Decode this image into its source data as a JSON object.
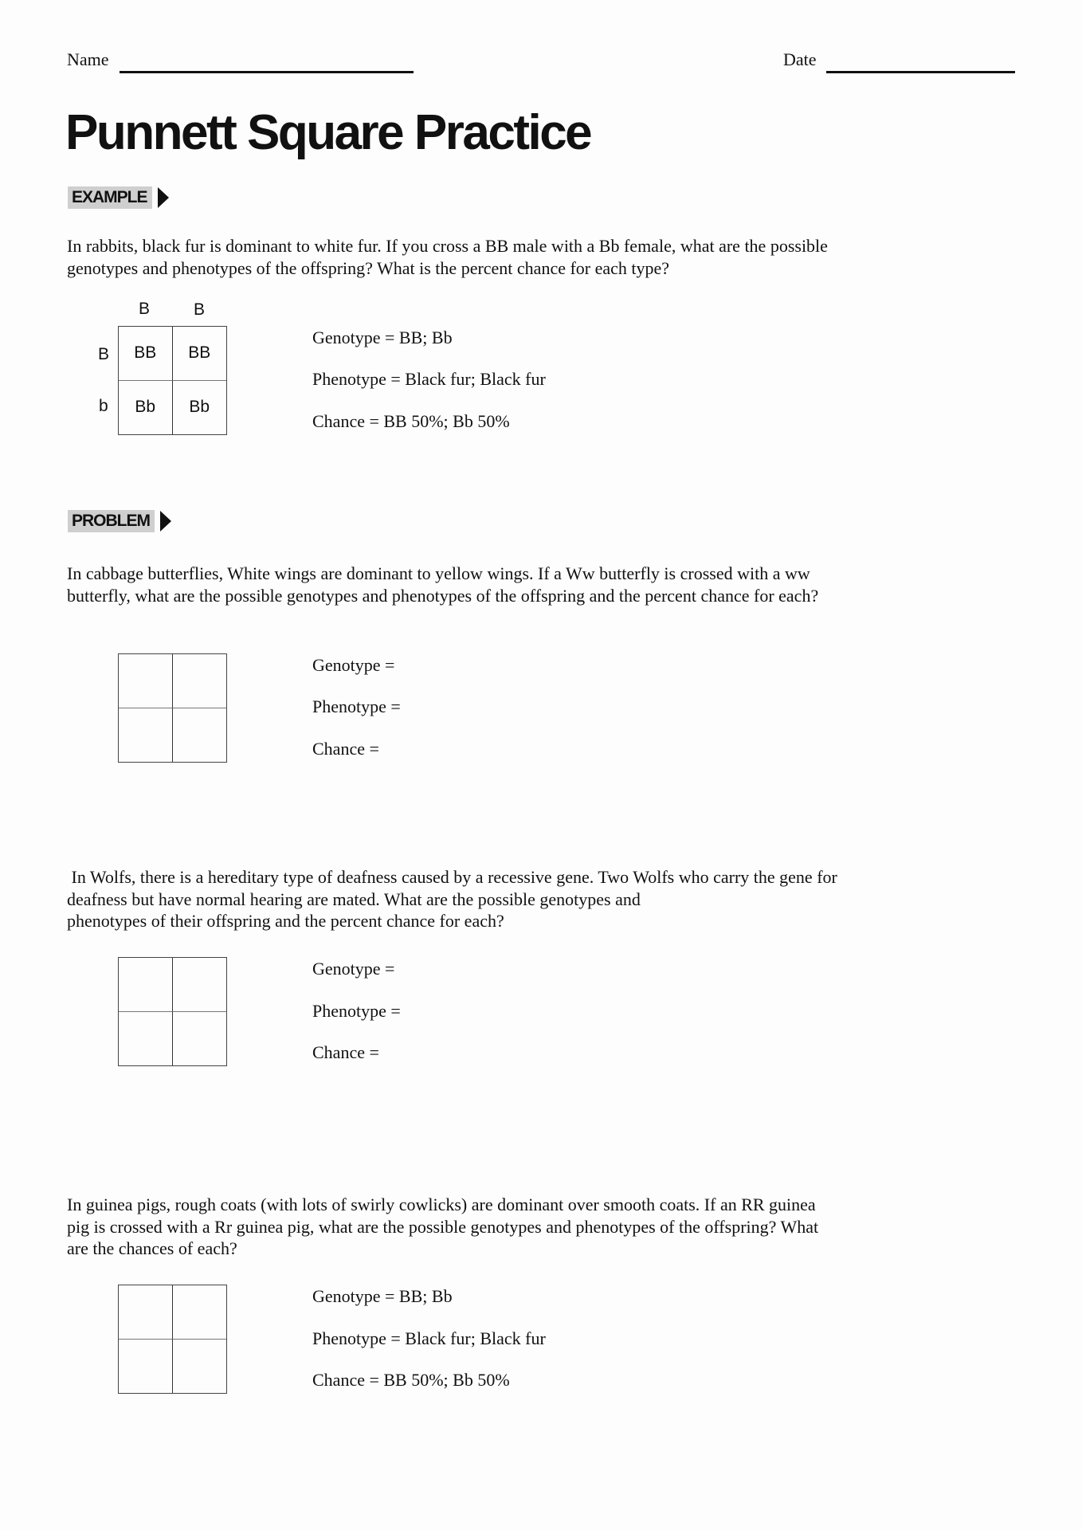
{
  "header": {
    "name_label": "Name",
    "date_label": "Date"
  },
  "title": "Punnett Square Practice",
  "example": {
    "badge": "EXAMPLE",
    "question_lines": [
      "In rabbits, black fur is dominant to white fur. If you cross a BB male with a Bb female, what are the possible",
      "genotypes and phenotypes of the offspring? What is the percent chance for each type?"
    ],
    "punnett": {
      "top_alleles": [
        "B",
        "B"
      ],
      "side_alleles": [
        "B",
        "b"
      ],
      "cells": [
        "BB",
        "BB",
        "Bb",
        "Bb"
      ]
    },
    "answers": {
      "genotype": "Genotype = BB; Bb",
      "phenotype": "Phenotype = Black fur; Black fur",
      "chance": "Chance = BB 50%; Bb 50%"
    }
  },
  "problem_badge": "PROBLEM",
  "problems": [
    {
      "question_lines": [
        "In cabbage butterflies, White wings are dominant to yellow wings. If a Ww butterfly is crossed with a ww",
        "butterfly, what are the possible genotypes and phenotypes of the offspring and the percent chance for each?"
      ],
      "cells": [
        "",
        "",
        "",
        ""
      ],
      "answers": {
        "genotype": "Genotype =",
        "phenotype": "Phenotype =",
        "chance": "Chance ="
      }
    },
    {
      "question_lines": [
        " In Wolfs, there is a hereditary type of deafness caused by a recessive gene. Two Wolfs who carry the gene for",
        "deafness but have normal hearing are mated. What are the possible genotypes and",
        "phenotypes of their offspring and the percent chance for each?"
      ],
      "cells": [
        "",
        "",
        "",
        ""
      ],
      "answers": {
        "genotype": "Genotype =",
        "phenotype": "Phenotype =",
        "chance": "Chance ="
      }
    },
    {
      "question_lines": [
        "In guinea pigs, rough coats (with lots of swirly cowlicks) are dominant over smooth coats. If an RR guinea",
        "pig is crossed with a Rr guinea pig, what are the possible genotypes and phenotypes of the offspring? What",
        "are the chances of each?"
      ],
      "cells": [
        "",
        "",
        "",
        ""
      ],
      "answers": {
        "genotype": "Genotype = BB; Bb",
        "phenotype": "Phenotype = Black fur; Black fur",
        "chance": "Chance = BB 50%; Bb 50%"
      }
    }
  ]
}
